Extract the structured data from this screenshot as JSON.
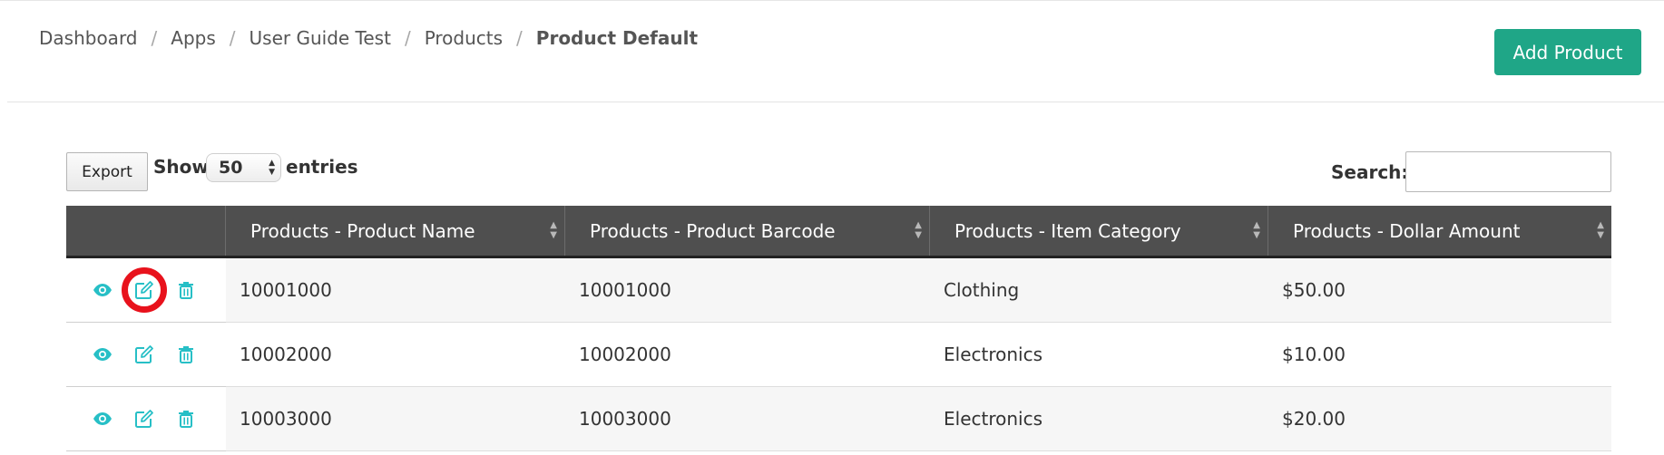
{
  "breadcrumb": {
    "items": [
      "Dashboard",
      "Apps",
      "User Guide Test",
      "Products",
      "Product Default"
    ],
    "separator": "/"
  },
  "header": {
    "add_button_label": "Add Product",
    "accent_color": "#1fa687"
  },
  "controls": {
    "export_label": "Export",
    "show_label": "Show",
    "entries_value": "50",
    "entries_label": "entries",
    "search_label": "Search:",
    "search_value": ""
  },
  "table": {
    "columns": [
      "Products - Product Name",
      "Products - Product Barcode",
      "Products - Item Category",
      "Products - Dollar Amount"
    ],
    "rows": [
      {
        "name": "10001000",
        "barcode": "10001000",
        "category": "Clothing",
        "amount": "$50.00"
      },
      {
        "name": "10002000",
        "barcode": "10002000",
        "category": "Electronics",
        "amount": "$10.00"
      },
      {
        "name": "10003000",
        "barcode": "10003000",
        "category": "Electronics",
        "amount": "$20.00"
      }
    ],
    "row_actions": [
      "eye-icon",
      "edit-icon",
      "trash-icon"
    ],
    "icon_color": "#27bfc6",
    "highlighted_action": {
      "row": 0,
      "icon": "edit-icon",
      "color": "#e8121c"
    }
  }
}
